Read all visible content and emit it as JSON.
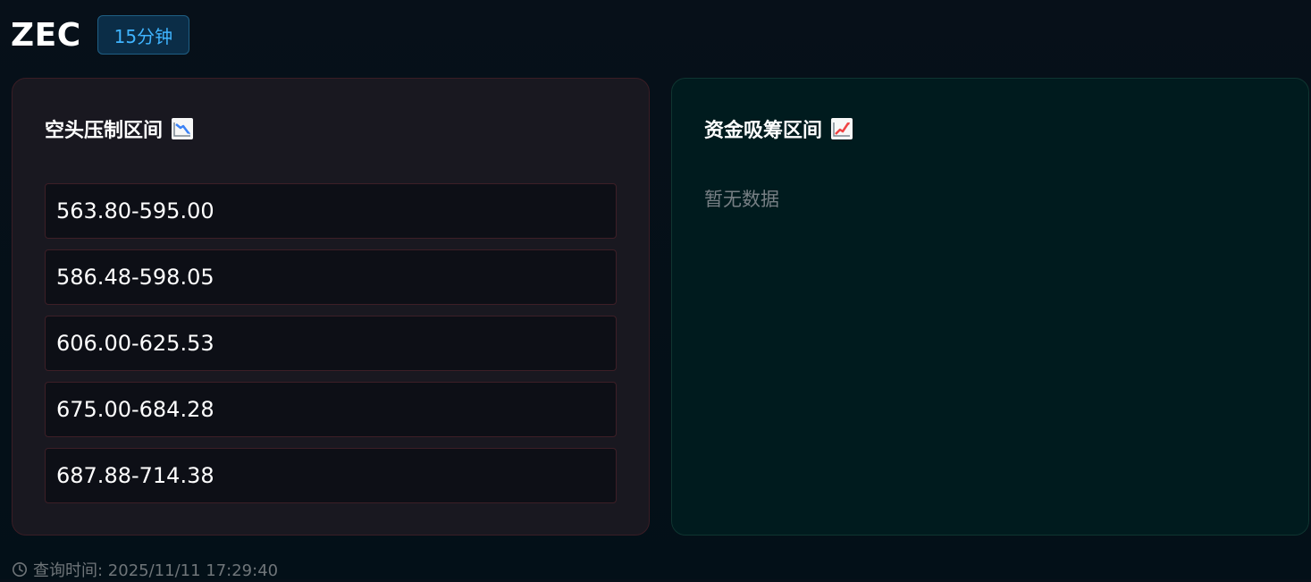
{
  "header": {
    "symbol": "ZEC",
    "timeframe": "15分钟"
  },
  "left_panel": {
    "title": "空头压制区间",
    "icon": "chart-decreasing-icon",
    "zones": [
      "563.80-595.00",
      "586.48-598.05",
      "606.00-625.53",
      "675.00-684.28",
      "687.88-714.38"
    ]
  },
  "right_panel": {
    "title": "资金吸筹区间",
    "icon": "chart-increasing-icon",
    "empty_text": "暂无数据"
  },
  "footer": {
    "query_time": "查询时间: 2025/11/11 17:29:40",
    "icon": "clock-icon"
  },
  "colors": {
    "background": "#071019",
    "left_panel": "#191820",
    "right_panel": "#001b1e",
    "timeframe_text": "#3fb4ff"
  }
}
